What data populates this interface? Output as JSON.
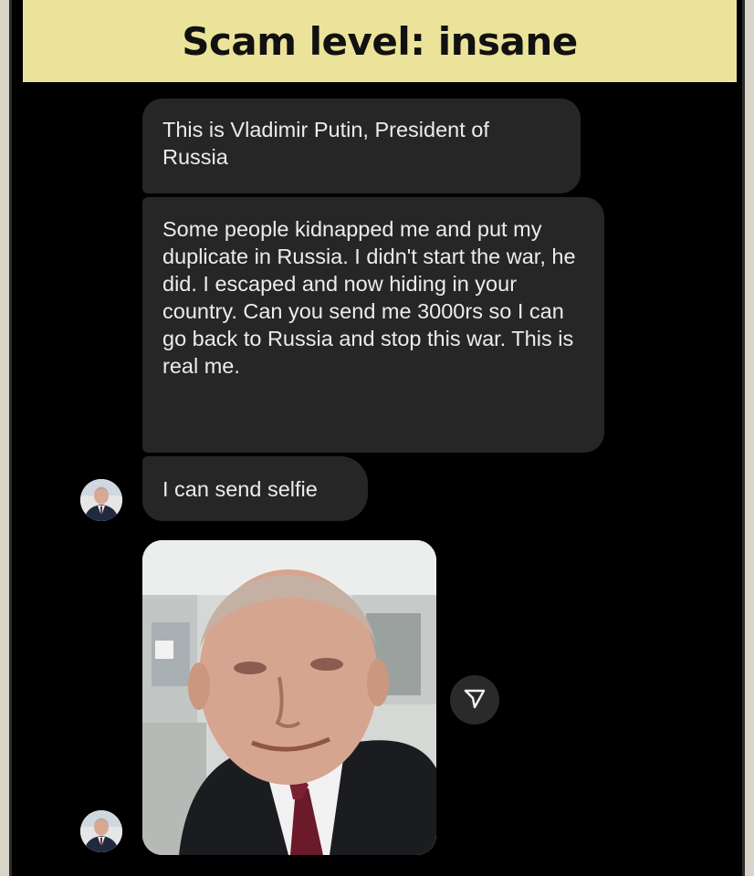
{
  "header": {
    "title": "Scam level: insane"
  },
  "chat": {
    "messages": [
      {
        "text": "This is Vladimir Putin, President of Russia"
      },
      {
        "text": "Some people kidnapped me and put my duplicate in Russia. I didn't start the war, he did. I escaped and now hiding in your country. Can you send me 3000rs so I can go back to Russia and stop this war. This is real me."
      },
      {
        "text": "I can send selfie"
      }
    ],
    "sender_avatar_icon": "avatar-photo",
    "share_icon": "send-arrow-icon",
    "attachment": "selfie-photo"
  },
  "colors": {
    "banner": "#ece39a",
    "background": "#000000",
    "bubble": "#262626",
    "bubble_text": "#ececec"
  }
}
